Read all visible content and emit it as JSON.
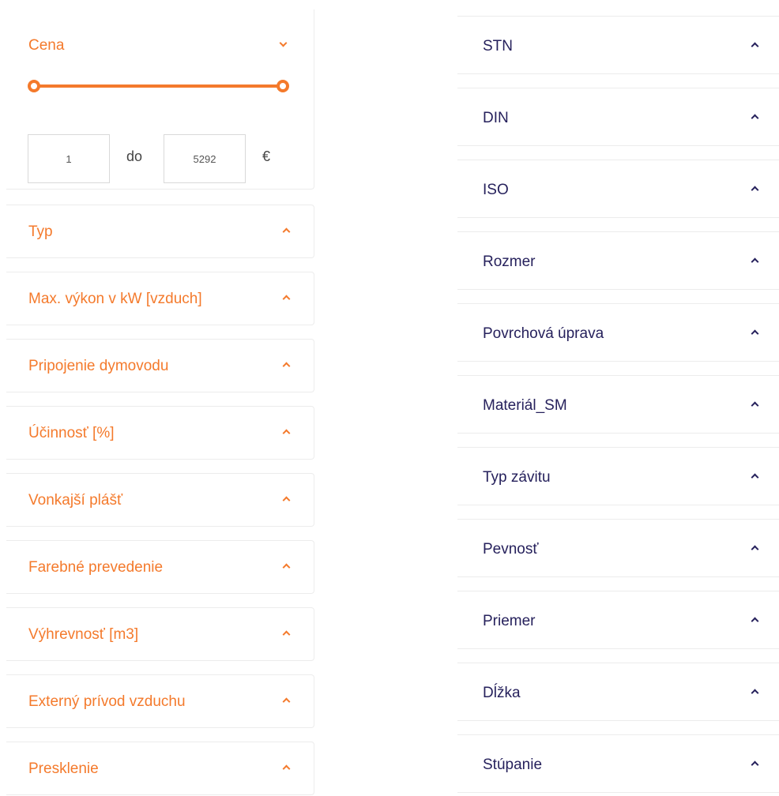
{
  "price_filter": {
    "title": "Cena",
    "min_value": "1",
    "max_value": "5292",
    "separator": "do",
    "currency": "€",
    "expanded": true,
    "accent_color": "#f47a2c"
  },
  "left_filters": [
    {
      "label": "Typ"
    },
    {
      "label": "Max. výkon v kW [vzduch]"
    },
    {
      "label": "Pripojenie dymovodu"
    },
    {
      "label": "Účinnosť [%]"
    },
    {
      "label": "Vonkajší plášť"
    },
    {
      "label": "Farebné prevedenie"
    },
    {
      "label": "Výhrevnosť [m3]"
    },
    {
      "label": "Externý prívod vzduchu"
    },
    {
      "label": "Presklenie"
    }
  ],
  "right_filters": [
    {
      "label": "STN"
    },
    {
      "label": "DIN"
    },
    {
      "label": "ISO"
    },
    {
      "label": "Rozmer"
    },
    {
      "label": "Povrchová úprava"
    },
    {
      "label": "Materiál_SM"
    },
    {
      "label": "Typ závitu"
    },
    {
      "label": "Pevnosť"
    },
    {
      "label": "Priemer"
    },
    {
      "label": "Dĺžka"
    },
    {
      "label": "Stúpanie"
    }
  ],
  "colors": {
    "left_text": "#f47a2c",
    "right_text": "#26215c",
    "border": "#ececec"
  },
  "icons": {
    "collapse": "chevron-down-icon",
    "expand": "chevron-up-icon"
  }
}
